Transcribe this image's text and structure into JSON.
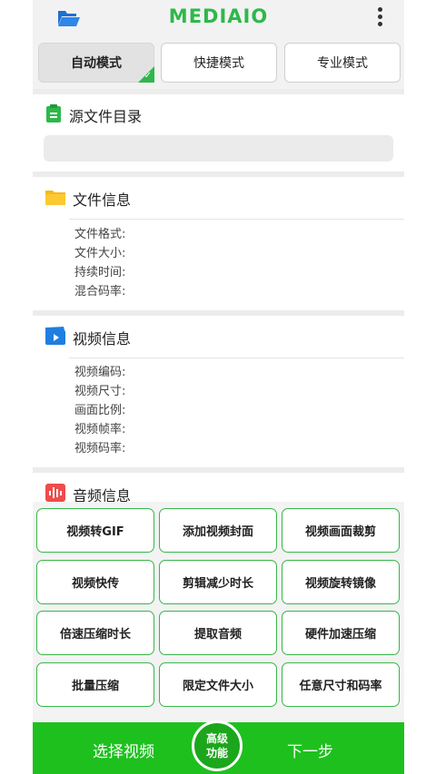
{
  "header": {
    "logo": "MEDIAIO",
    "folder_icon": "open-folder-icon",
    "menu_icon": "more-vertical-icon"
  },
  "modes": [
    {
      "label": "自动模式",
      "active": true
    },
    {
      "label": "快捷模式",
      "active": false
    },
    {
      "label": "专业模式",
      "active": false
    }
  ],
  "source": {
    "title": "源文件目录",
    "path_value": ""
  },
  "file_info": {
    "title": "文件信息",
    "fields": [
      "文件格式:",
      "文件大小:",
      "持续时间:",
      "混合码率:"
    ]
  },
  "video_info": {
    "title": "视频信息",
    "fields": [
      "视频编码:",
      "视频尺寸:",
      "画面比例:",
      "视频帧率:",
      "视频码率:"
    ]
  },
  "audio_info": {
    "title": "音频信息"
  },
  "actions": [
    "视频转GIF",
    "添加视频封面",
    "视频画面裁剪",
    "视频快传",
    "剪辑减少时长",
    "视频旋转镜像",
    "倍速压缩时长",
    "提取音频",
    "硬件加速压缩",
    "批量压缩",
    "限定文件大小",
    "任意尺寸和码率"
  ],
  "bottom": {
    "select_label": "选择视频",
    "advanced_line1": "高级",
    "advanced_line2": "功能",
    "next_label": "下一步"
  },
  "colors": {
    "brand_green": "#2db84a",
    "bottom_bar": "#1ec01e"
  }
}
